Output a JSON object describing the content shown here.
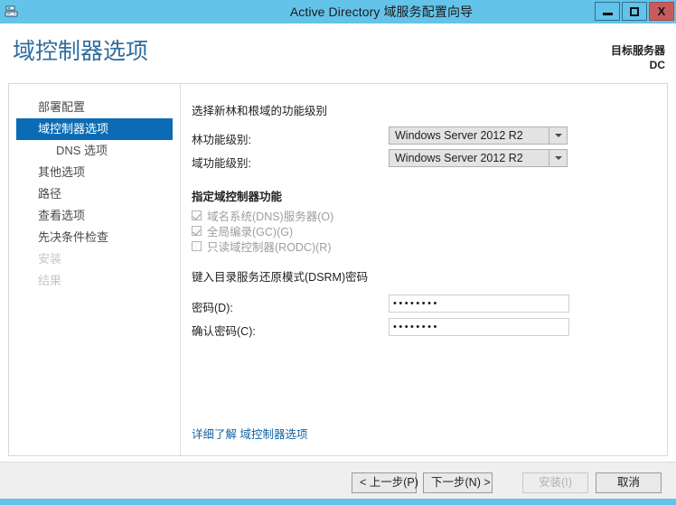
{
  "window": {
    "title": "Active Directory 域服务配置向导",
    "icon": "server-icon",
    "controls": {
      "minimize": "–",
      "maximize": "□",
      "close": "X"
    },
    "titlebar_color": "#64c3e8",
    "accent_color": "#64c3e8"
  },
  "header": {
    "page_title": "域控制器选项",
    "target_server_label": "目标服务器",
    "target_server_value": "DC",
    "title_color": "#2f6d9e"
  },
  "sidebar": {
    "items": [
      {
        "label": "部署配置",
        "state": "normal",
        "sub": false
      },
      {
        "label": "域控制器选项",
        "state": "active",
        "sub": false
      },
      {
        "label": "DNS 选项",
        "state": "normal",
        "sub": true
      },
      {
        "label": "其他选项",
        "state": "normal",
        "sub": false
      },
      {
        "label": "路径",
        "state": "normal",
        "sub": false
      },
      {
        "label": "查看选项",
        "state": "normal",
        "sub": false
      },
      {
        "label": "先决条件检查",
        "state": "normal",
        "sub": false
      },
      {
        "label": "安装",
        "state": "disabled",
        "sub": false
      },
      {
        "label": "结果",
        "state": "disabled",
        "sub": false
      }
    ],
    "active_color": "#0b6cb5"
  },
  "main": {
    "functional_level": {
      "section_title": "选择新林和根域的功能级别",
      "forest_label": "林功能级别:",
      "forest_value": "Windows Server 2012 R2",
      "domain_label": "域功能级别:",
      "domain_value": "Windows Server 2012 R2"
    },
    "capabilities": {
      "section_title": "指定域控制器功能",
      "options": [
        {
          "label": "域名系统(DNS)服务器(O)",
          "checked": true,
          "disabled": true
        },
        {
          "label": "全局编录(GC)(G)",
          "checked": true,
          "disabled": true
        },
        {
          "label": "只读域控制器(RODC)(R)",
          "checked": false,
          "disabled": true
        }
      ]
    },
    "dsrm": {
      "section_title": "键入目录服务还原模式(DSRM)密码",
      "password_label": "密码(D):",
      "password_value": "••••••••",
      "confirm_label": "确认密码(C):",
      "confirm_value": "••••••••"
    },
    "help_link": "详细了解 域控制器选项"
  },
  "footer": {
    "back_label": "< 上一步(P)",
    "next_label": "下一步(N) >",
    "install_label": "安装(I)",
    "install_disabled": true,
    "cancel_label": "取消"
  }
}
